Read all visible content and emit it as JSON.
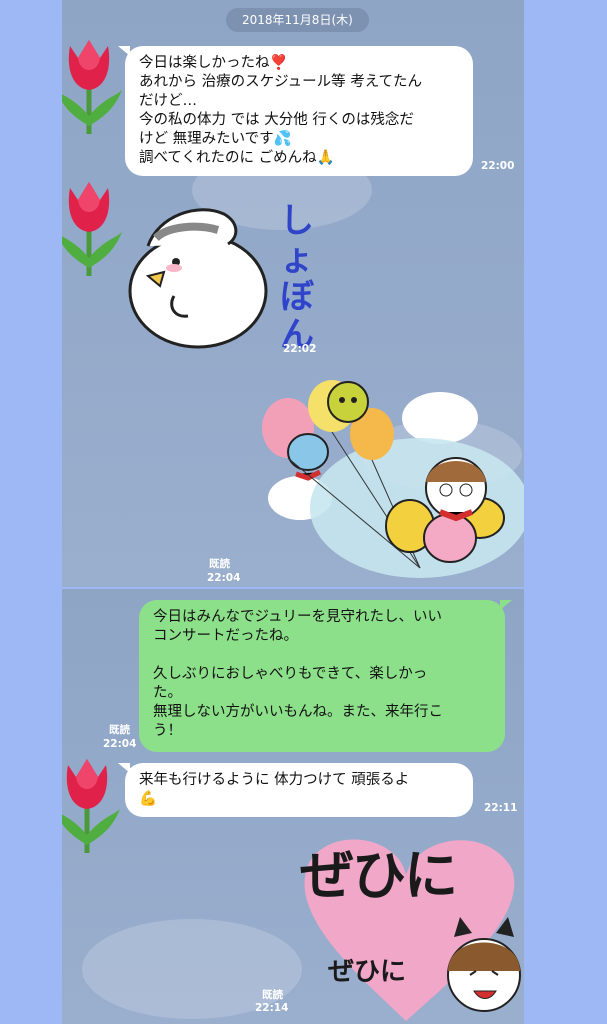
{
  "date_label": "2018年11月8日(木)",
  "read_label": "既読",
  "messages": [
    {
      "lines": [
        "今日は楽しかったね❣️",
        "あれから 治療のスケジュール等 考えてたん",
        "だけど…",
        "今の私の体力 では 大分他  行くのは残念だ",
        "けど  無理みたいです💦",
        "調べてくれたのに  ごめんね🙏"
      ],
      "time": "22:00"
    },
    {
      "sticker_text": "しょぼん",
      "time": "22:02"
    },
    {
      "time": "22:04"
    },
    {
      "lines": [
        "今日はみんなでジュリーを見守れたし、いい",
        "コンサートだったね。",
        "",
        "久しぶりにおしゃべりもできて、楽しかっ",
        "た。",
        "無理しない方がいいもんね。また、来年行こ",
        "う！"
      ],
      "time": "22:04"
    },
    {
      "lines": [
        "来年も行けるように  体力つけて  頑張るよ",
        "💪"
      ],
      "time": "22:11"
    },
    {
      "sticker_text_big": "ぜひに",
      "sticker_text_small": "ぜひに",
      "time": "22:14"
    }
  ],
  "colors": {
    "background": "#9db8f4",
    "chat_bg": "#93a9c9",
    "my_bubble": "#8de08a",
    "their_bubble": "#ffffff"
  }
}
